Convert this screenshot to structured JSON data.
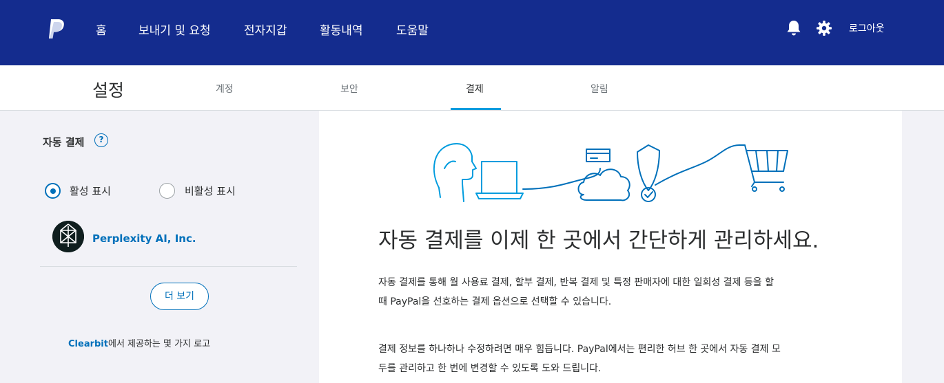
{
  "header": {
    "nav": [
      "홈",
      "보내기 및 요청",
      "전자지갑",
      "활동내역",
      "도움말"
    ],
    "icons": [
      "bell-icon",
      "gear-icon"
    ],
    "logout_label": "로그아웃",
    "background_color": "#142c8e"
  },
  "subnav": {
    "title": "설정",
    "tabs": [
      "계정",
      "보안",
      "결제",
      "알림"
    ],
    "active_tab": "결제"
  },
  "left": {
    "section_title": "자동 결제",
    "help_symbol": "?",
    "radio_active_label": "활성 표시",
    "radio_inactive_label": "비활성 표시",
    "selected_filter": "활성 표시",
    "merchant_name": "Perplexity AI, Inc.",
    "more_button_label": "더 보기",
    "clearbit_brand": "Clearbit",
    "clearbit_rest": "에서 제공하는 몇 가지 로고"
  },
  "content": {
    "headline": "자동 결제를 이제 한 곳에서 간단하게 관리하세요.",
    "para1_line1": "자동 결제를 통해 월 사용료 결제, 할부 결제, 반복 결제 및 특정 판매자에 대한 일회성 결제 등을 할",
    "para1_line2": "때 PayPal을 선호하는 결제 옵션으로 선택할 수 있습니다.",
    "para2_line1": "결제 정보를 하나하나 수정하려면 매우 힘듭니다. PayPal에서는 편리한 허브 한 곳에서 자동 결제 모",
    "para2_line2": "두를 관리하고 한 번에 변경할 수 있도록 도와 드립니다."
  },
  "colors": {
    "accent": "#0070ba",
    "highlight": "#009cde",
    "text": "#2c2e2f"
  }
}
